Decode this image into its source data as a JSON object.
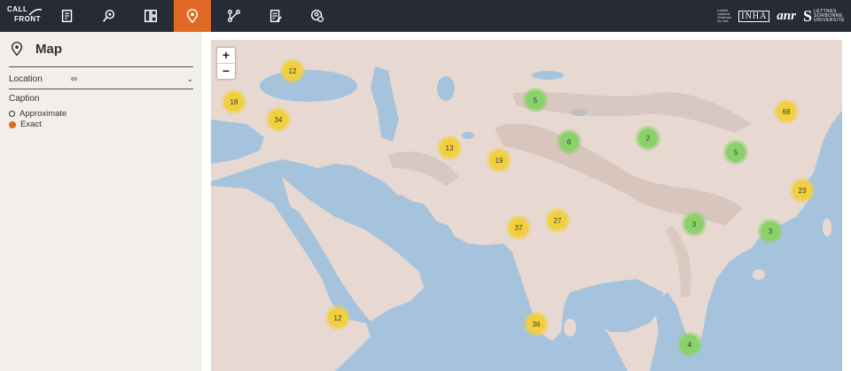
{
  "header": {
    "logo": {
      "line1": "CALL",
      "line2": "FRONT"
    },
    "nav_icons": [
      "document-icon",
      "search-pin-icon",
      "grid-icon",
      "map-pin-icon",
      "network-icon",
      "edit-list-icon",
      "settings-person-icon"
    ],
    "active_nav": "map-pin-icon",
    "partners": {
      "inha_small": "Institut national d'histoire de l'art",
      "inha": "INHA",
      "anr": "anr",
      "sorbonne_s": "S",
      "sorbonne_text": "LETTRES SORBONNE UNIVERSITÉ"
    }
  },
  "sidebar": {
    "title": "Map",
    "location_label": "Location",
    "location_value": "∞",
    "caption_label": "Caption",
    "legend": [
      {
        "label": "Approximate",
        "style": "ring"
      },
      {
        "label": "Exact",
        "style": "filled",
        "color": "#e06a25"
      }
    ]
  },
  "map": {
    "zoom_in": "+",
    "zoom_out": "−",
    "colors": {
      "water": "#a6c3dd",
      "land": "#e7d9d2",
      "mountain": "#d1bdb5",
      "cluster_yellow": "#f1cf3f",
      "cluster_green": "#8ad16a"
    },
    "clusters": [
      {
        "count": "12",
        "color": "yellow"
      },
      {
        "count": "18",
        "color": "yellow"
      },
      {
        "count": "34",
        "color": "yellow"
      },
      {
        "count": "5",
        "color": "green"
      },
      {
        "count": "6",
        "color": "green"
      },
      {
        "count": "2",
        "color": "green"
      },
      {
        "count": "68",
        "color": "yellow"
      },
      {
        "count": "13",
        "color": "yellow"
      },
      {
        "count": "19",
        "color": "yellow"
      },
      {
        "count": "5",
        "color": "green"
      },
      {
        "count": "23",
        "color": "yellow"
      },
      {
        "count": "37",
        "color": "yellow"
      },
      {
        "count": "27",
        "color": "yellow"
      },
      {
        "count": "3",
        "color": "green"
      },
      {
        "count": "3",
        "color": "green"
      },
      {
        "count": "12",
        "color": "yellow"
      },
      {
        "count": "36",
        "color": "yellow"
      },
      {
        "count": "4",
        "color": "green"
      }
    ]
  }
}
